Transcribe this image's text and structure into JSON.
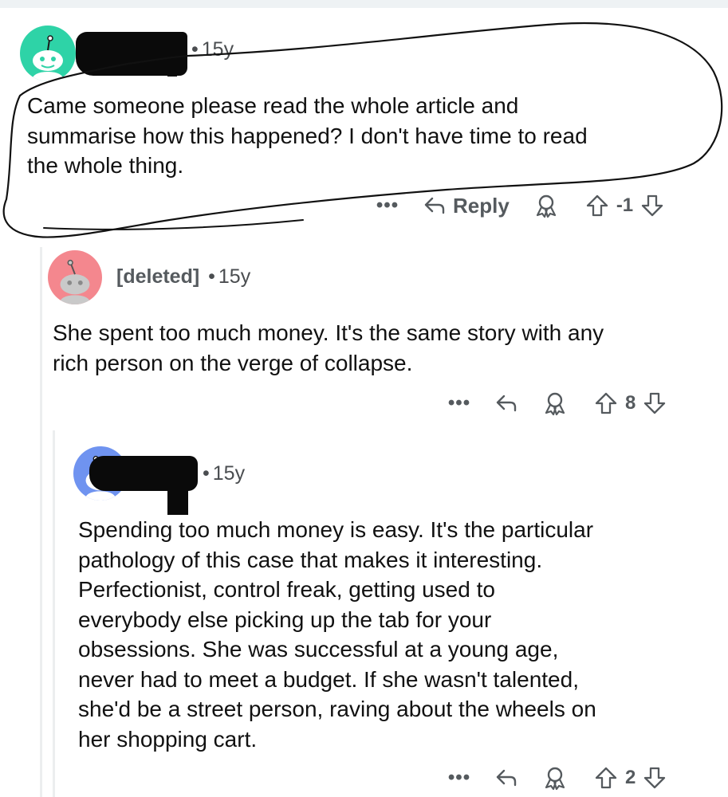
{
  "comments": [
    {
      "age": "15y",
      "body_lines": [
        "Came someone please read the whole article and",
        "summarise how this happened? I don't have time to read",
        "the whole thing."
      ],
      "reply_label": "Reply",
      "score": "-1",
      "avatar_color": "#2ed3a7"
    },
    {
      "author": "[deleted]",
      "age": "15y",
      "body_lines": [
        "She spent too much money. It's the same story with any",
        "rich person on the verge of collapse."
      ],
      "score": "8",
      "avatar_color": "#f4878e"
    },
    {
      "age": "15y",
      "body_lines": [
        "Spending too much money is easy. It's the particular",
        "pathology of this case that makes it interesting.",
        "Perfectionist, control freak, getting used to",
        "everybody else picking up the tab for your",
        "obsessions. She was successful at a young age,",
        "never had to meet a budget. If she wasn't talented,",
        "she'd be a street person, raving about the wheels on",
        "her shopping cart."
      ],
      "score": "2",
      "avatar_color": "#6f93f0"
    }
  ],
  "more_glyph": "•••",
  "separator": "•",
  "icons": [
    "more-options-icon",
    "reply-arrow-icon",
    "award-icon",
    "upvote-arrow-icon",
    "downvote-arrow-icon",
    "snoo-avatar-icon"
  ]
}
